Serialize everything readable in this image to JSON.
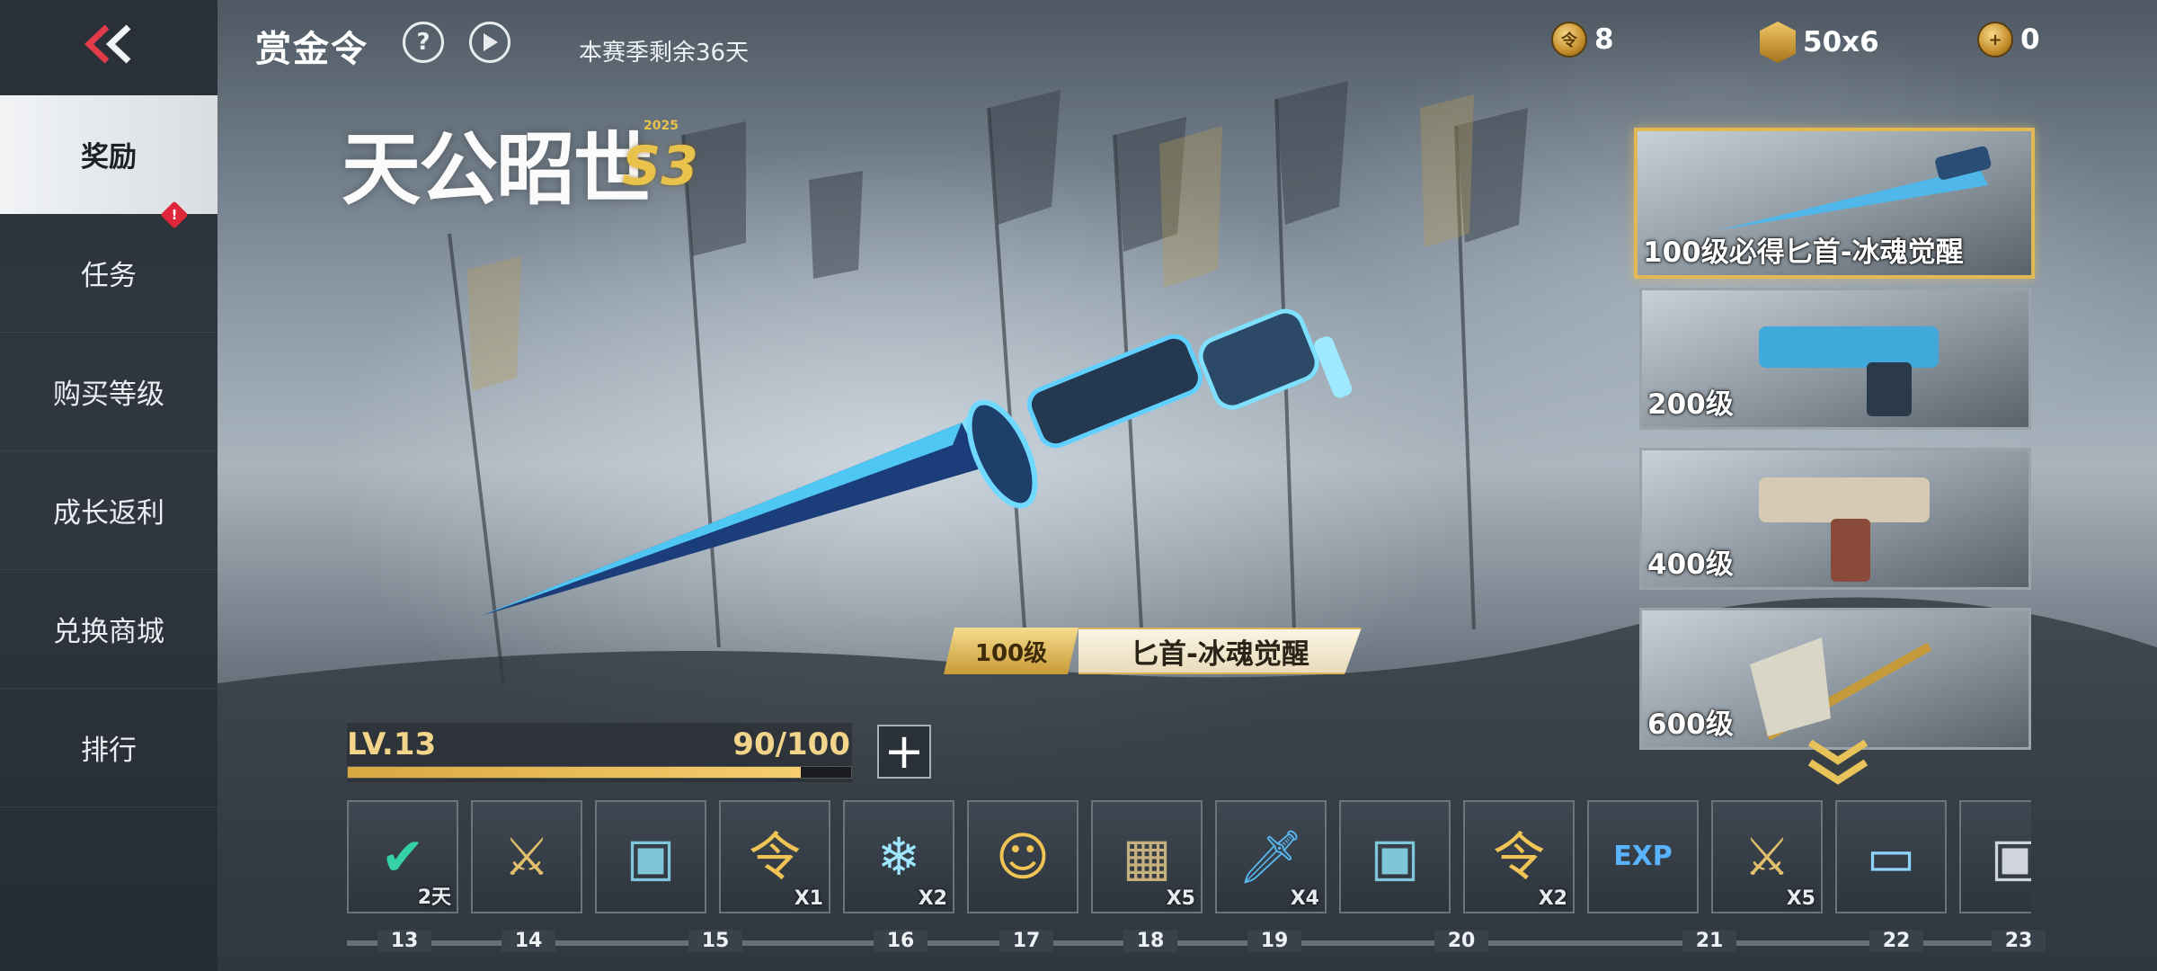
{
  "header": {
    "title": "赏金令",
    "help_icon": "question-icon",
    "play_icon": "play-icon",
    "season_remaining": "本赛季剩余36天",
    "currencies": [
      {
        "icon": "gold-coin-icon",
        "value": "8"
      },
      {
        "icon": "medal-icon",
        "value": "50x6"
      },
      {
        "icon": "plus-coin-icon",
        "value": "0"
      }
    ]
  },
  "sidebar": {
    "back_icon": "back-chevrons-icon",
    "items": [
      {
        "label": "奖励",
        "active": true
      },
      {
        "label": "任务",
        "badge": "!"
      },
      {
        "label": "购买等级"
      },
      {
        "label": "成长返利"
      },
      {
        "label": "兑换商城"
      },
      {
        "label": "排行"
      }
    ]
  },
  "logo": {
    "text": "天公昭世",
    "season": "S3",
    "year": "2025"
  },
  "featured": {
    "level": "100级",
    "name": "匕首-冰魂觉醒"
  },
  "progress": {
    "level_text": "LV.13",
    "progress_text": "90/100",
    "fraction": 0.9
  },
  "preview_cards": [
    {
      "label": "100级必得匕首-冰魂觉醒",
      "selected": true
    },
    {
      "label": "200级"
    },
    {
      "label": "400级"
    },
    {
      "label": "600级"
    }
  ],
  "rewards": [
    {
      "icon": "claimed-check-icon",
      "qty": "2天"
    },
    {
      "icon": "crossed-rifles-coin-icon",
      "qty": ""
    },
    {
      "icon": "supply-crate-icon",
      "qty": ""
    },
    {
      "icon": "gold-token-icon",
      "qty": "X1"
    },
    {
      "icon": "snowflake-camo-icon",
      "qty": "X2"
    },
    {
      "icon": "avatar-card-icon",
      "qty": ""
    },
    {
      "icon": "desert-camo-icon",
      "qty": "X5"
    },
    {
      "icon": "knife-icon",
      "qty": "X4"
    },
    {
      "icon": "supply-crate-icon",
      "qty": ""
    },
    {
      "icon": "gold-token-icon",
      "qty": "X2"
    },
    {
      "icon": "exp-card-icon",
      "qty": ""
    },
    {
      "icon": "crossed-rifles-coin-icon",
      "qty": "X5"
    },
    {
      "icon": "weapon-card-icon",
      "qty": ""
    },
    {
      "icon": "claimed-crate-icon",
      "qty": ""
    }
  ],
  "level_numbers": [
    "13",
    "14",
    "15",
    "16",
    "17",
    "18",
    "19",
    "20",
    "21",
    "22",
    "23"
  ],
  "colors": {
    "accent_gold": "#e0b856",
    "active_tab": "#f1f3f5",
    "badge_red": "#e0263a"
  }
}
